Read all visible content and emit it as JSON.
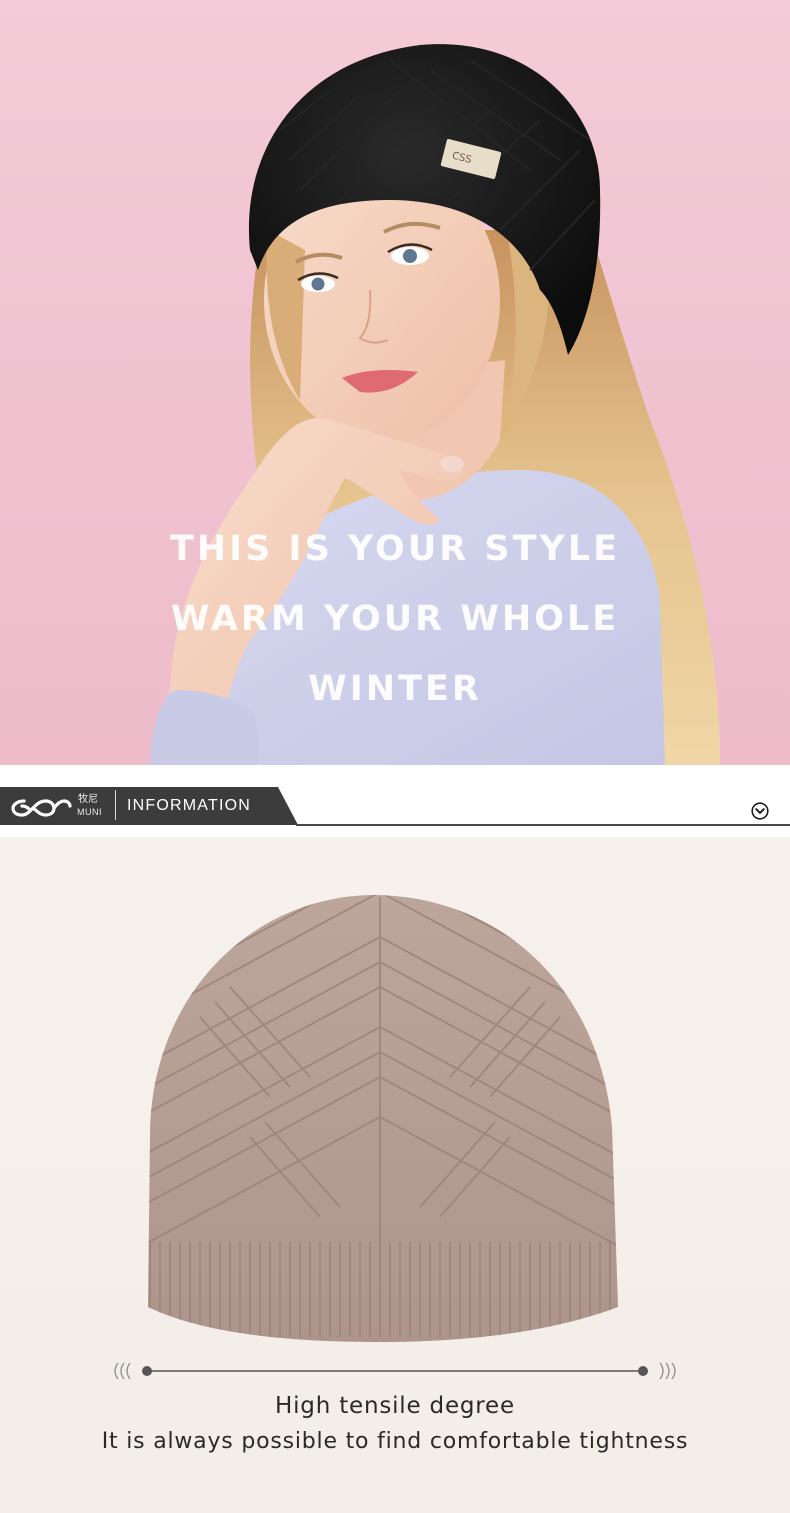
{
  "hero": {
    "lines": [
      "THIS IS YOUR STYLE",
      "WARM YOUR WHOLE",
      "WINTER"
    ]
  },
  "info_bar": {
    "brand_cn": "牧尼",
    "brand_en": "MUNI",
    "tab_label": "INFORMATION"
  },
  "product": {
    "caption_title": "High tensile degree",
    "caption_subtitle": "It is always possible to find comfortable tightness",
    "measure_left_icon": "sound-waves-left-icon",
    "measure_right_icon": "sound-waves-right-icon"
  },
  "colors": {
    "hero_bg": "#f0c3d1",
    "tab_bg": "#3c3c3c",
    "beanie": "#b49e96",
    "product_bg": "#f6f0eb",
    "caption_text": "#2a2a2a"
  },
  "icons": {
    "brand": "muni-logo-icon",
    "expand": "chevron-down-circle-icon"
  }
}
